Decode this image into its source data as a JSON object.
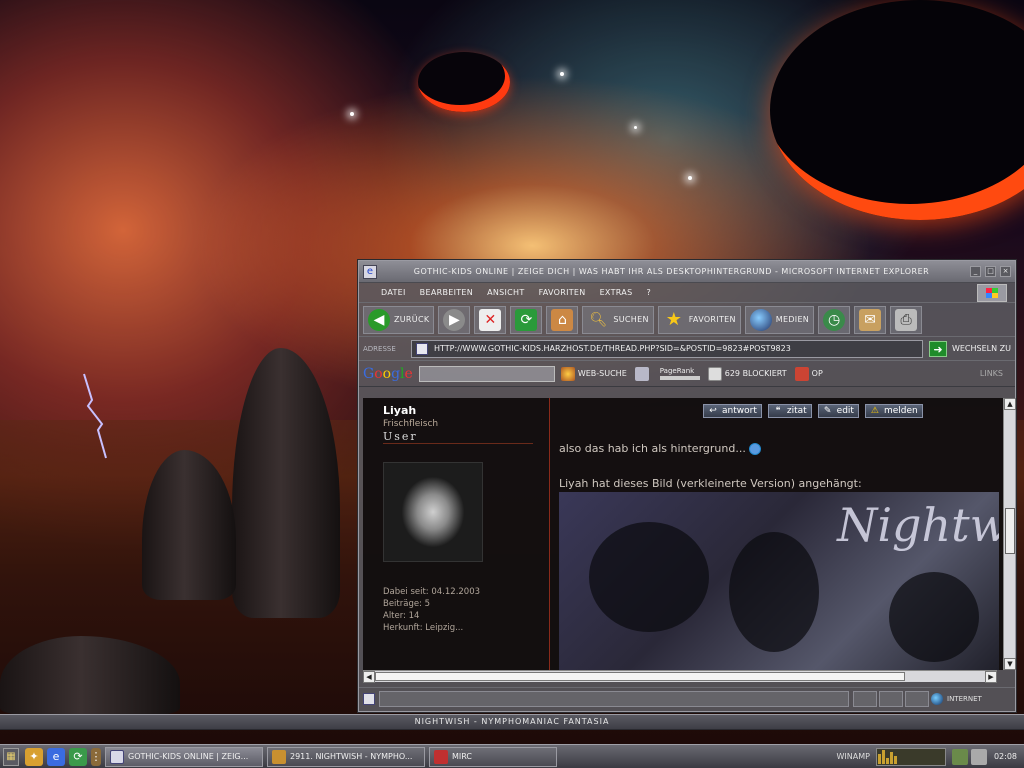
{
  "window": {
    "title": "GOTHIC-KIDS ONLINE | Zeige dich | was habt ihr als Desktophintergrund - Microsoft Internet Explorer",
    "controls": [
      "_",
      "□",
      "×"
    ]
  },
  "menubar": {
    "items": [
      "Datei",
      "Bearbeiten",
      "Ansicht",
      "Favoriten",
      "Extras",
      "?"
    ]
  },
  "toolbar": {
    "back": "Zurück",
    "search": "Suchen",
    "favorites": "Favoriten",
    "media": "Medien"
  },
  "addressbar": {
    "label": "Adresse",
    "url": "http://www.gothic-kids.harzhost.de/thread.php?sid=&postid=9823#post9823",
    "go": "Wechseln zu"
  },
  "googlebar": {
    "logo": "Google",
    "web_search": "Web-Suche",
    "pagerank": "PageRank",
    "blocked": "629 blockiert",
    "options": "Op",
    "links": "Links"
  },
  "post": {
    "user": {
      "name": "Liyah",
      "rank": "Frischfleisch",
      "title": "User",
      "joined": "Dabei seit: 04.12.2003",
      "posts": "Beiträge: 5",
      "age": "Alter: 14",
      "origin": "Herkunft: Leipzig..."
    },
    "actions": {
      "reply": "antwort",
      "quote": "zitat",
      "edit": "edit",
      "report": "melden"
    },
    "text_line1": "also das hab ich als hintergrund...",
    "text_line2": "Liyah hat dieses Bild (verkleinerte Version) angehängt:",
    "image_text": "Nightw"
  },
  "status": {
    "zone": "Internet"
  },
  "now_playing": "Nightwish - Nymphomaniac Fantasia",
  "taskbar": {
    "items": [
      "GOTHIC-KIDS ONLINE | Zeig...",
      "2911. Nightwish - Nympho...",
      "mIRC"
    ],
    "winamp": "Winamp",
    "clock": "02:08"
  },
  "colors": {
    "accent_red": "#8a2a1a",
    "chrome": "#6a6a72",
    "go_green": "#1f8c2a"
  }
}
